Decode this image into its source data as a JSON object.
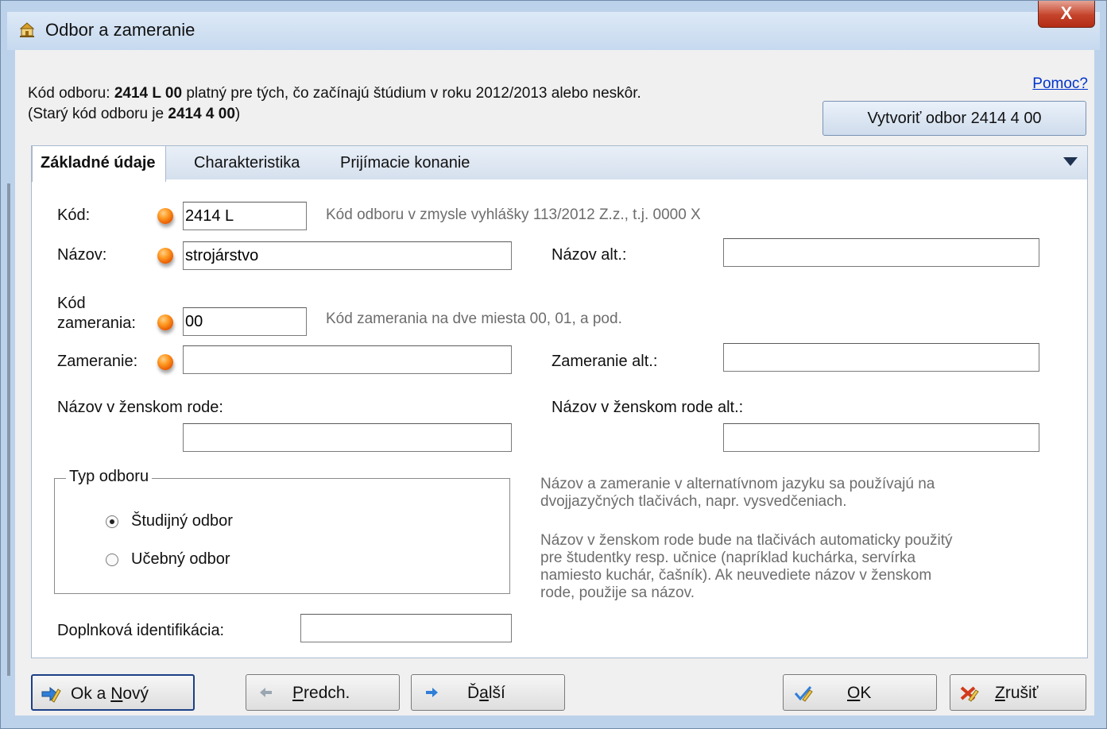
{
  "window": {
    "title": "Odbor a zameranie",
    "close_label": "X"
  },
  "header": {
    "code_prefix": "Kód odboru: ",
    "code_value": "2414 L 00",
    "code_suffix": " platný pre tých, čo začínajú štúdium v roku 2012/2013 alebo neskôr.",
    "old_prefix": "(Starý kód odboru je ",
    "old_value": "2414 4 00",
    "old_suffix": ")",
    "help_link": "Pomoc?",
    "create_button": "Vytvoriť odbor 2414 4 00"
  },
  "tabs": [
    {
      "label": "Základné údaje",
      "active": true
    },
    {
      "label": "Charakteristika",
      "active": false
    },
    {
      "label": "Prijímacie konanie",
      "active": false
    }
  ],
  "form": {
    "kod_label": "Kód:",
    "kod_value": "2414 L",
    "kod_hint": "Kód odboru v zmysle vyhlášky 113/2012 Z.z., t.j. 0000 X",
    "nazov_label": "Názov:",
    "nazov_value": "strojárstvo",
    "nazov_alt_label": "Názov alt.:",
    "nazov_alt_value": "",
    "kod_zamerania_label_1": "Kód",
    "kod_zamerania_label_2": "zamerania:",
    "kod_zamerania_value": "00",
    "kod_zamerania_hint": "Kód zamerania na dve miesta 00, 01, a pod.",
    "zameranie_label": "Zameranie:",
    "zameranie_value": "",
    "zameranie_alt_label": "Zameranie alt.:",
    "zameranie_alt_value": "",
    "nazov_zensky_label": "Názov v ženskom rode:",
    "nazov_zensky_value": "",
    "nazov_zensky_alt_label": "Názov v ženskom rode alt.:",
    "nazov_zensky_alt_value": "",
    "doplnkova_label": "Doplnková identifikácia:",
    "doplnkova_value": ""
  },
  "typ_odboru": {
    "title": "Typ odboru",
    "options": [
      {
        "label": "Študijný odbor",
        "selected": true
      },
      {
        "label": "Učebný odbor",
        "selected": false
      }
    ]
  },
  "notes": {
    "alt_line1": "Názov a zameranie v alternatívnom jazyku sa používajú na",
    "alt_line2": "dvojjazyčných tlačivách, napr. vysvedčeniach.",
    "fem_line1": "Názov v ženskom rode bude na tlačivách automaticky použitý",
    "fem_line2": "pre študentky resp. učnice (napríklad kuchárka, servírka",
    "fem_line3": "namiesto kuchár, čašník). Ak neuvediete názov v ženskom",
    "fem_line4": "rode, použije sa názov."
  },
  "buttons": {
    "ok_novy_a": "Ok a ",
    "ok_novy_b": "N",
    "ok_novy_c": "ový",
    "predch_a": "P",
    "predch_b": "redch.",
    "dalsi_a": "Ď",
    "dalsi_b": "a",
    "dalsi_c": "lší",
    "ok_a": "O",
    "ok_b": "K",
    "zrusit_a": "Z",
    "zrusit_b": "rušiť"
  },
  "colors": {
    "accent_link": "#0033cc",
    "required_dot": "#ff8a1a",
    "close_button": "#c5432a"
  }
}
